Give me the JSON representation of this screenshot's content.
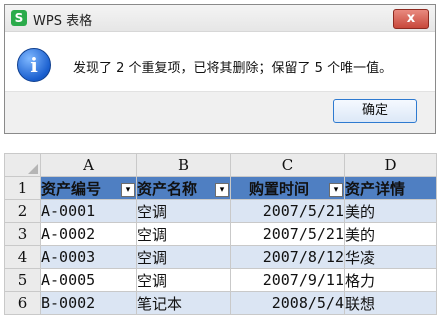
{
  "dialog": {
    "title": "WPS 表格",
    "app_icon_letter": "S",
    "close_glyph": "x",
    "info_glyph": "i",
    "message": "发现了 2 个重复项，已将其删除；保留了 5 个唯一值。",
    "ok_label": "确定"
  },
  "sheet": {
    "columns": [
      "A",
      "B",
      "C",
      "D"
    ],
    "row_numbers": [
      "1",
      "2",
      "3",
      "4",
      "5",
      "6"
    ],
    "headers": [
      "资产编号",
      "资产名称",
      "购置时间",
      "资产详情"
    ],
    "filter_glyph": "▾",
    "rows": [
      [
        "A-0001",
        "空调",
        "2007/5/21",
        "美的"
      ],
      [
        "A-0002",
        "空调",
        "2007/5/21",
        "美的"
      ],
      [
        "A-0003",
        "空调",
        "2007/8/12",
        "华凌"
      ],
      [
        "A-0005",
        "空调",
        "2007/9/11",
        "格力"
      ],
      [
        "B-0002",
        "笔记本",
        "2008/5/4",
        "联想"
      ]
    ]
  },
  "colors": {
    "header_fill": "#4f7fc2",
    "band_fill": "#dbe5f3",
    "app_icon": "#2bab4b"
  }
}
